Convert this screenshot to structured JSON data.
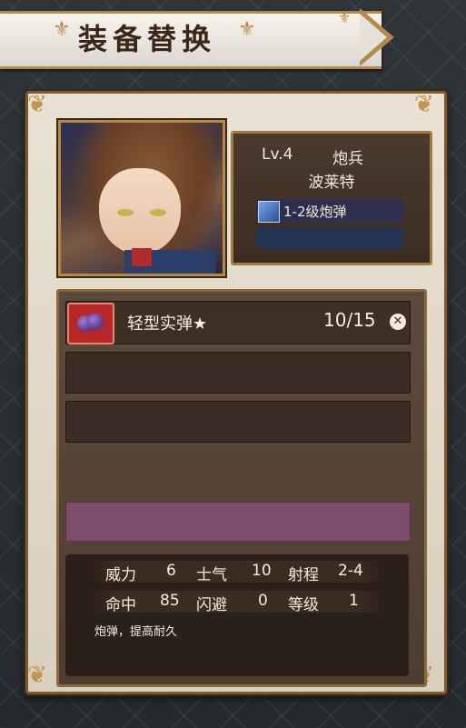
{
  "header": {
    "title": "装备替换"
  },
  "character": {
    "level": "Lv.4",
    "class": "炮兵",
    "name": "波莱特",
    "ammo_label": "1-2级炮弹"
  },
  "equipment": {
    "item_name": "轻型实弹★",
    "item_count": "10/15",
    "remove_symbol": "✕"
  },
  "stats": {
    "row1": [
      {
        "label": "威力",
        "value": "6"
      },
      {
        "label": "士气",
        "value": "10"
      },
      {
        "label": "射程",
        "value": "2-4"
      }
    ],
    "row2": [
      {
        "label": "命中",
        "value": "85"
      },
      {
        "label": "闪避",
        "value": "0"
      },
      {
        "label": "等级",
        "value": "1"
      }
    ],
    "description": "炮弹，提高耐久"
  },
  "colors": {
    "accent": "#b4894a",
    "panel": "#5d4a3c",
    "highlight_slot": "#7e4d6c",
    "item_icon_bg": "#b82727"
  },
  "icons": {
    "item": "cannonball-icon",
    "ammo": "shell-icon",
    "remove": "close-circle-icon"
  }
}
